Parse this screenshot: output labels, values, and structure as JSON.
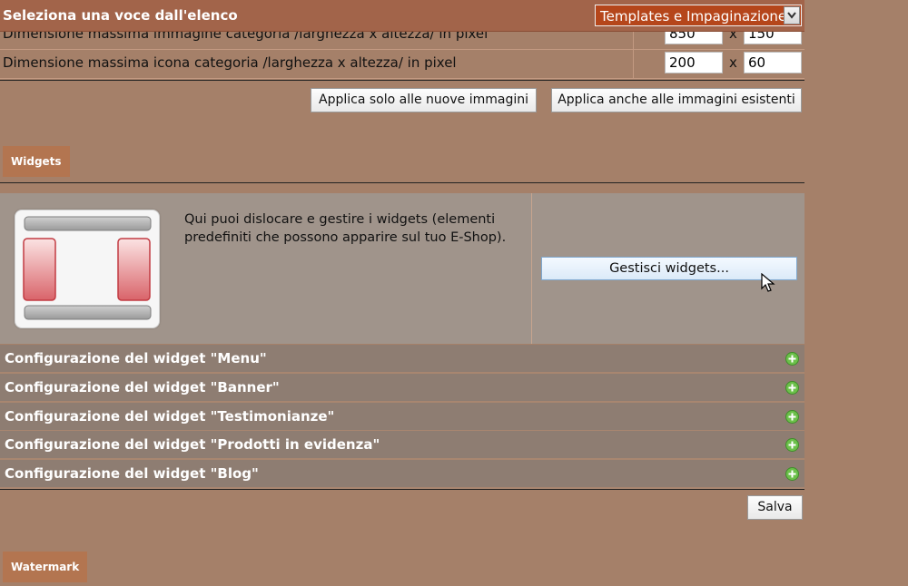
{
  "header": {
    "title": "Seleziona una voce dall'elenco",
    "select_value": "Templates e Impaginazione"
  },
  "dimensions": {
    "rows": [
      {
        "label": "Dimensione massima immagine categoria /larghezza x altezza/ in pixel",
        "width": "850",
        "x": "x",
        "height": "150"
      },
      {
        "label": "Dimensione massima icona categoria /larghezza x altezza/ in pixel",
        "width": "200",
        "x": "x",
        "height": "60"
      }
    ],
    "apply_new_label": "Applica solo alle nuove immagini",
    "apply_all_label": "Applica anche alle immagini esistenti"
  },
  "widgets": {
    "section_label": "Widgets",
    "description": "Qui puoi dislocare e gestire i widgets (elementi predefiniti che possono apparire sul tuo E-Shop).",
    "manage_label": "Gestisci widgets...",
    "config_rows": [
      "Configurazione del widget \"Menu\"",
      "Configurazione del widget \"Banner\"",
      "Configurazione del widget \"Testimonianze\"",
      "Configurazione del widget \"Prodotti in evidenza\"",
      "Configurazione del widget \"Blog\""
    ],
    "save_label": "Salva"
  },
  "watermark": {
    "section_label": "Watermark"
  },
  "colors": {
    "background": "#a58069",
    "topbar": "#a2644a",
    "select_bg": "#b5461b",
    "section_tab": "#b37550",
    "config_row": "#8e7d72",
    "plus_icon": "#6cc04a"
  }
}
